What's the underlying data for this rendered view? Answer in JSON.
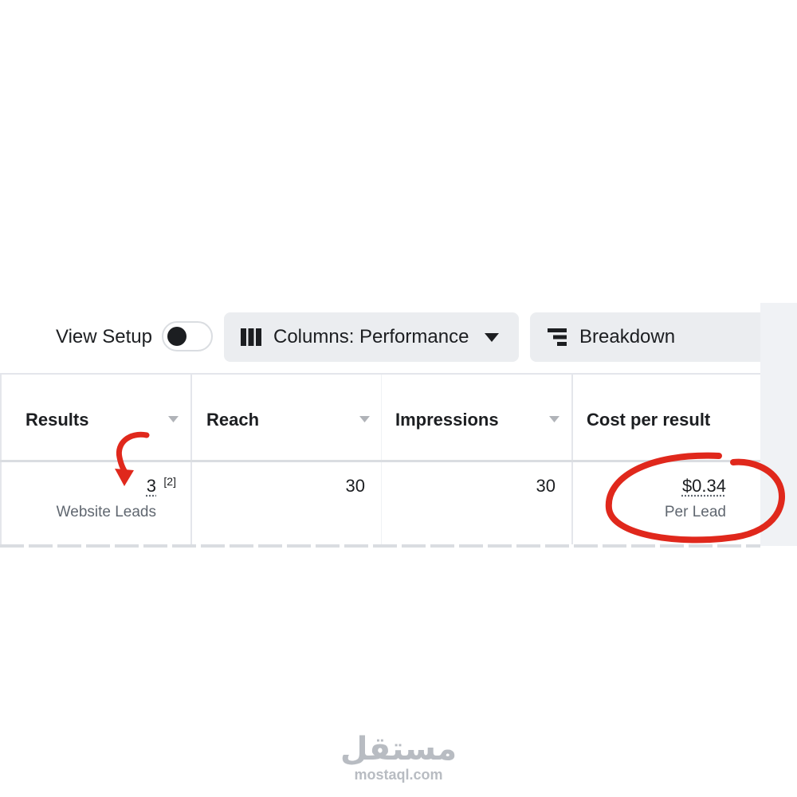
{
  "toolbar": {
    "view_setup_label": "View Setup",
    "view_setup_on": false,
    "columns_label": "Columns: Performance",
    "breakdown_label": "Breakdown"
  },
  "table": {
    "headers": [
      {
        "label": "Results",
        "sortable": true
      },
      {
        "label": "Reach",
        "sortable": true
      },
      {
        "label": "Impressions",
        "sortable": true
      },
      {
        "label": "Cost per result",
        "sortable": false
      }
    ],
    "row": {
      "results_value": "3",
      "results_footnote": "[2]",
      "results_sub": "Website Leads",
      "reach_value": "30",
      "impressions_value": "30",
      "cost_value": "$0.34",
      "cost_sub": "Per Lead"
    }
  },
  "annotations": {
    "color": "#e0281c"
  },
  "watermark": {
    "logo": "مستقل",
    "url": "mostaql.com"
  },
  "colors": {
    "button_bg": "#ebedf0",
    "text": "#1c1e21",
    "secondary_text": "#606770",
    "border": "#e4e6eb"
  }
}
